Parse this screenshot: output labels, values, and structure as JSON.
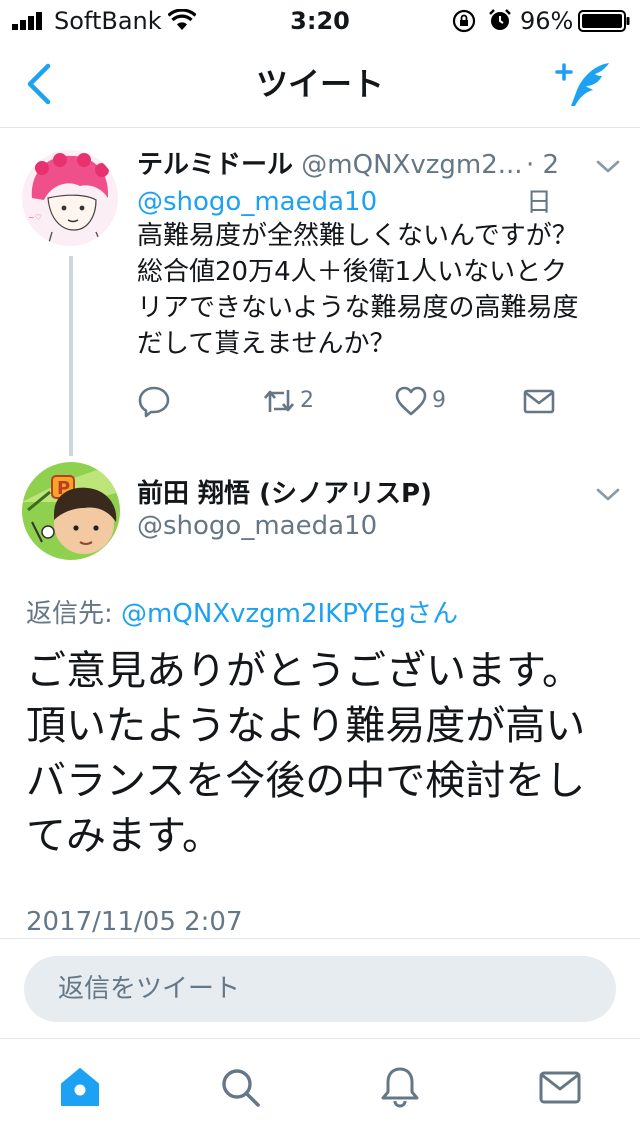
{
  "status_bar": {
    "carrier": "SoftBank",
    "time": "3:20",
    "battery": "96%"
  },
  "nav": {
    "title": "ツイート",
    "accent_color": "#1da1f2"
  },
  "parent_tweet": {
    "name": "テルミドール",
    "handle": "@mQNXvzgm2...",
    "time": "· 2日",
    "mention": "@shogo_maeda10",
    "lines": [
      "高難易度が全然難しくないんですが？",
      "総合値20万4人＋後衛1人いないとク",
      "リアできないような難易度の高難易度",
      "だして貰えませんか？"
    ],
    "retweet_count": "2",
    "like_count": "9"
  },
  "main_tweet": {
    "name": "前田 翔悟 (シノアリスP)",
    "handle": "@shogo_maeda10",
    "reply_to_label": "返信先: ",
    "reply_to_handle": "@mQNXvzgm2IKPYEgさん",
    "lines": [
      "ご意見ありがとうございます。",
      "頂いたようなより難易度が高い",
      "バランスを今後の中で検討をし",
      "てみます。"
    ],
    "timestamp": "2017/11/05 2:07"
  },
  "reply_box": {
    "placeholder": "返信をツイート"
  },
  "tab_bar": {
    "icons": [
      "home-icon",
      "search-icon",
      "notifications-icon",
      "messages-icon"
    ]
  }
}
